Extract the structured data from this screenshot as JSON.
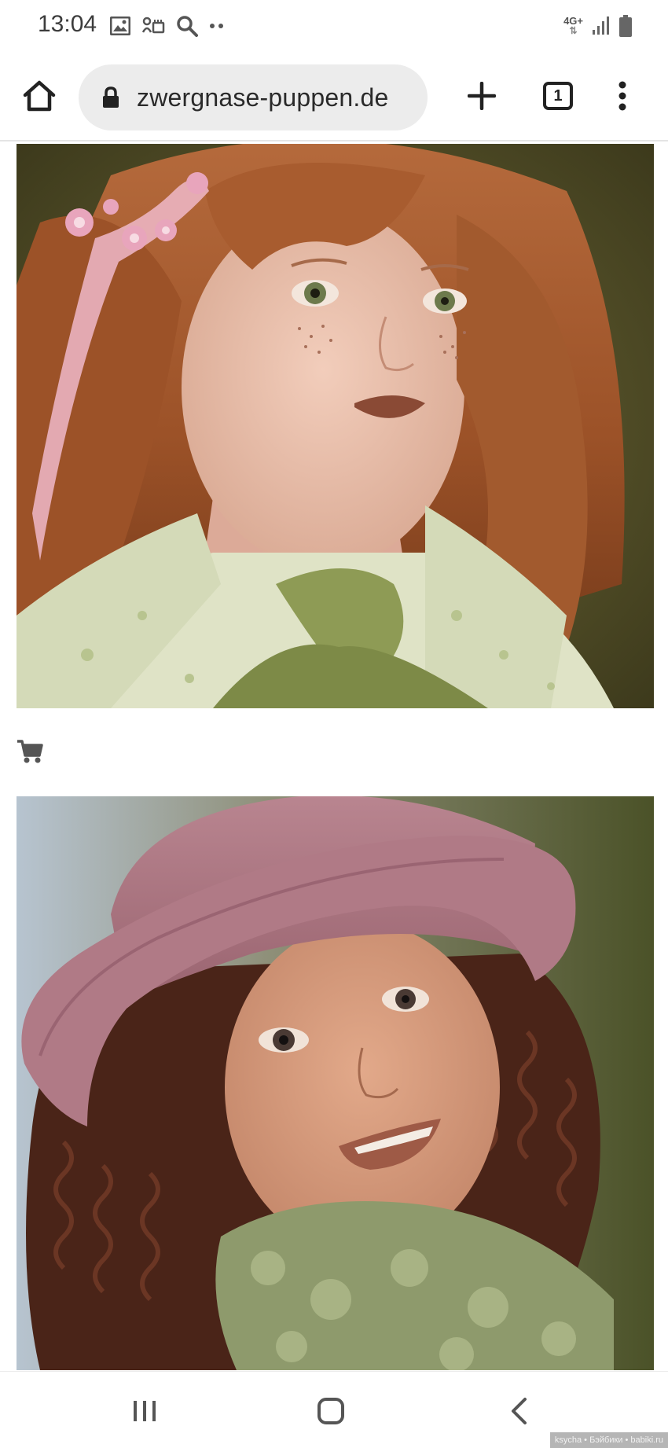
{
  "status_bar": {
    "time": "13:04",
    "left_icons": [
      "image-icon",
      "notification-icon",
      "search-icon",
      "more-dots-icon"
    ],
    "network_label": "4G+",
    "right_icons": [
      "signal-icon",
      "battery-icon"
    ]
  },
  "toolbar": {
    "url": "zwergnase-puppen.de",
    "tab_count": "1",
    "icons": [
      "home-icon",
      "lock-icon",
      "plus-icon",
      "tabs-icon",
      "kebab-menu-icon"
    ]
  },
  "content": {
    "images": [
      {
        "subject": "doll with auburn hair and flowered pink ribbon, green floral dress"
      },
      {
        "subject": "doll with curly dark hair, mauve felt hat and green fur scarf"
      }
    ],
    "cart_icon": "shopping-cart-icon"
  },
  "nav_bar": {
    "icons": [
      "recents-icon",
      "home-icon",
      "back-icon"
    ]
  },
  "watermark": "ksycha • Бэйбики • babiki.ru",
  "colors": {
    "urlbar_bg": "#ececec",
    "icon_dark": "#222222",
    "status_text": "#3c3c3c",
    "divider": "#e4e4e4"
  }
}
